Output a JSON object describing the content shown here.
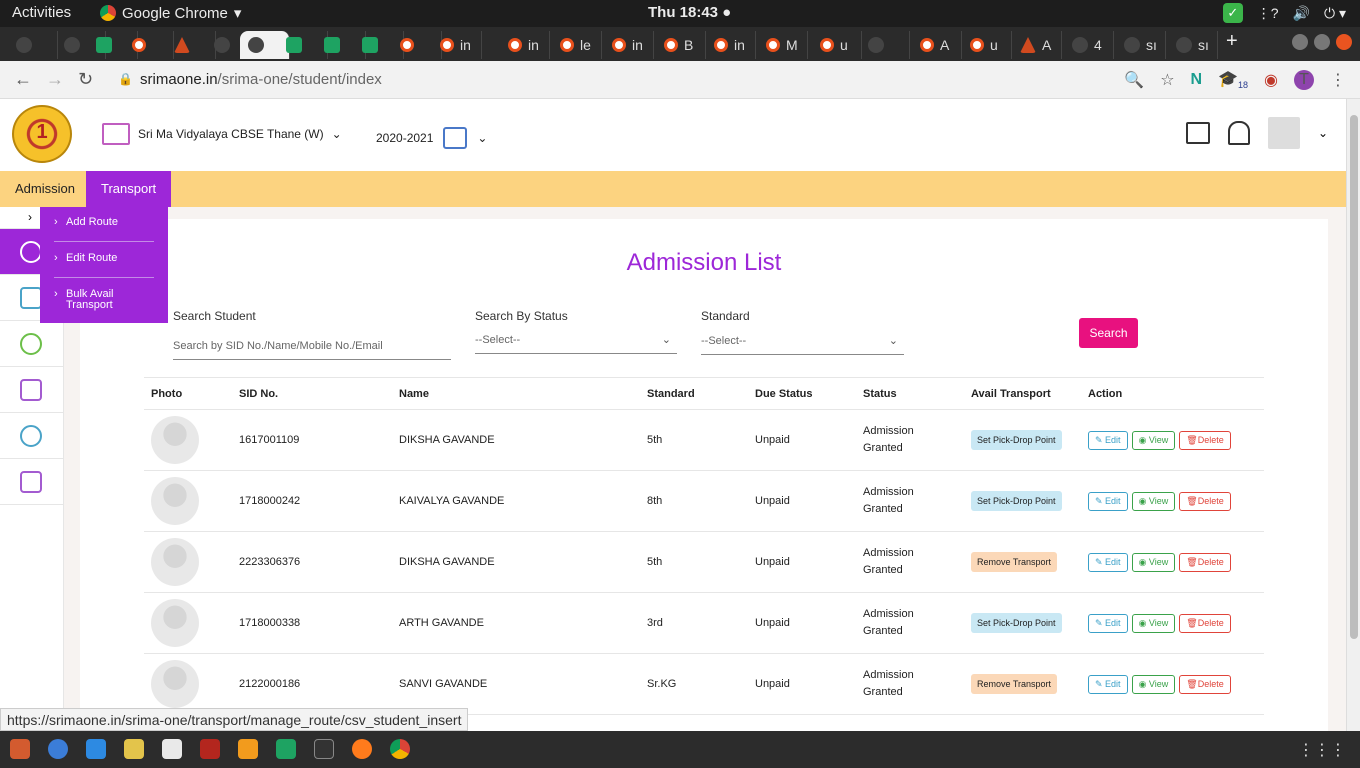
{
  "os": {
    "activities": "Activities",
    "app_name": "Google Chrome",
    "clock": "Thu 18:43 ●"
  },
  "browser": {
    "tabs": [
      "",
      "",
      "",
      "",
      "",
      "",
      "",
      "",
      "",
      "",
      "",
      "in",
      "in",
      "le",
      "in",
      "B",
      "in",
      "M",
      "u",
      "",
      "A",
      "u",
      "A",
      "4",
      "sı",
      "sı"
    ],
    "url_host": "srimaone.in",
    "url_path": "/srima-one/student/index",
    "extension_badge": "18",
    "profile_initial": "T",
    "status_url": "https://srimaone.in/srima-one/transport/manage_route/csv_student_insert"
  },
  "header": {
    "logo_text": "1",
    "school_name": "Sri Ma Vidyalaya CBSE Thane (W)",
    "academic_year": "2020-2021"
  },
  "menu": {
    "items": [
      "Admission",
      "Transport"
    ],
    "transport_dropdown": [
      "Add Route",
      "Edit Route",
      "Bulk Avail Transport"
    ]
  },
  "main": {
    "title": "Admission List",
    "search_student_label": "Search Student",
    "search_student_placeholder": "Search by SID No./Name/Mobile No./Email",
    "status_label": "Search By Status",
    "status_value": "--Select--",
    "standard_label": "Standard",
    "standard_value": "--Select--",
    "search_button": "Search"
  },
  "table": {
    "headers": [
      "Photo",
      "SID No.",
      "Name",
      "Standard",
      "Due Status",
      "Status",
      "Avail Transport",
      "Action"
    ],
    "actions": {
      "edit": "Edit",
      "view": "View",
      "delete": "Delete"
    },
    "rows": [
      {
        "sid": "1617001109",
        "name": "DIKSHA GAVANDE",
        "standard": "5th",
        "due": "Unpaid",
        "status": "Admission Granted",
        "transport": "Set Pick-Drop Point"
      },
      {
        "sid": "1718000242",
        "name": "KAIVALYA GAVANDE",
        "standard": "8th",
        "due": "Unpaid",
        "status": "Admission Granted",
        "transport": "Set Pick-Drop Point"
      },
      {
        "sid": "2223306376",
        "name": "DIKSHA GAVANDE",
        "standard": "5th",
        "due": "Unpaid",
        "status": "Admission Granted",
        "transport": "Remove Transport"
      },
      {
        "sid": "1718000338",
        "name": "ARTH GAVANDE",
        "standard": "3rd",
        "due": "Unpaid",
        "status": "Admission Granted",
        "transport": "Set Pick-Drop Point"
      },
      {
        "sid": "2122000186",
        "name": "SANVI GAVANDE",
        "standard": "Sr.KG",
        "due": "Unpaid",
        "status": "Admission Granted",
        "transport": "Remove Transport"
      }
    ]
  },
  "colors": {
    "accent_purple": "#9d27d8",
    "menu_bar": "#fcd380",
    "search_button": "#e8117f"
  }
}
